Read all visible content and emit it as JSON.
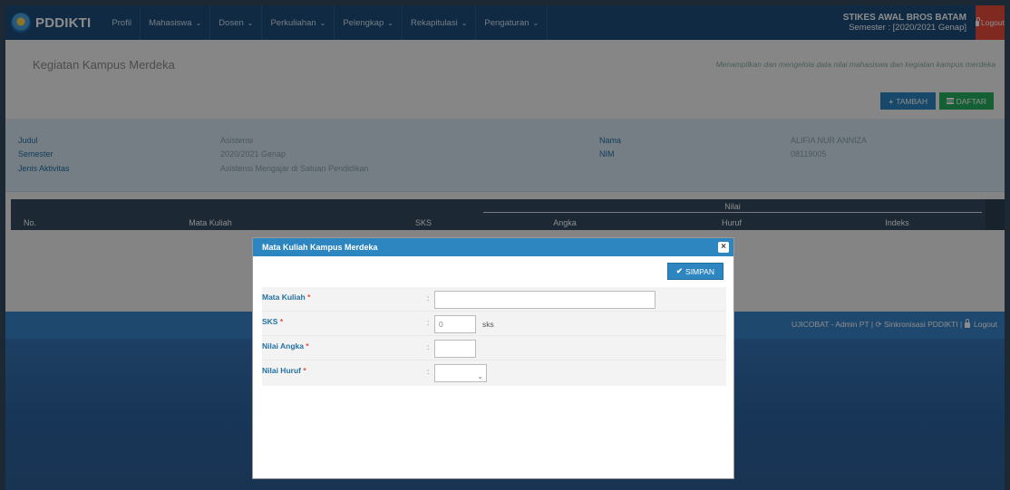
{
  "navbar": {
    "brand": "PDDIKTI",
    "menu": [
      {
        "label": "Profil",
        "caret": false
      },
      {
        "label": "Mahasiswa",
        "caret": true
      },
      {
        "label": "Dosen",
        "caret": true
      },
      {
        "label": "Perkuliahan",
        "caret": true
      },
      {
        "label": "Pelengkap",
        "caret": true
      },
      {
        "label": "Rekapitulasi",
        "caret": true
      },
      {
        "label": "Pengaturan",
        "caret": true
      }
    ],
    "campus_name": "STIKES AWAL BROS BATAM",
    "semester": "Semester : [2020/2021 Genap]",
    "logout": "Logout"
  },
  "page": {
    "title": "Kegiatan Kampus Merdeka",
    "subtitle": "Menampilkan dan mengelola data nilai mahasiswa dan kegiatan kampus merdeka",
    "add_button": "TAMBAH",
    "list_button": "DAFTAR"
  },
  "info": {
    "judul_label": "Judul",
    "judul_value": "Asistensi",
    "semester_label": "Semester",
    "semester_value": "2020/2021 Genap",
    "jenis_label": "Jenis Aktivitas",
    "jenis_value": "Asistensi Mengajar di Satuan Pendidikan",
    "nama_label": "Nama",
    "nama_value": "ALIFIA NUR ANNIZA",
    "nim_label": "NIM",
    "nim_value": "08119005"
  },
  "table": {
    "headers": {
      "no": "No.",
      "matkul": "Mata Kuliah",
      "sks": "SKS",
      "nilai": "Nilai",
      "angka": "Angka",
      "huruf": "Huruf",
      "indeks": "Indeks"
    }
  },
  "footer": {
    "text": "UJICOBAT - Admin PT | ",
    "sync": "Sinkronisasi PDDIKTI",
    "logout": "Logout"
  },
  "modal": {
    "title": "Mata Kuliah Kampus Merdeka",
    "close": "×",
    "save_button": "SIMPAN",
    "fields": {
      "matkul_label": "Mata Kuliah",
      "sks_label": "SKS",
      "sks_value": "0",
      "sks_suffix": "sks",
      "angka_label": "Nilai Angka",
      "huruf_label": "Nilai Huruf"
    },
    "required_mark": "*",
    "colon": ":"
  }
}
